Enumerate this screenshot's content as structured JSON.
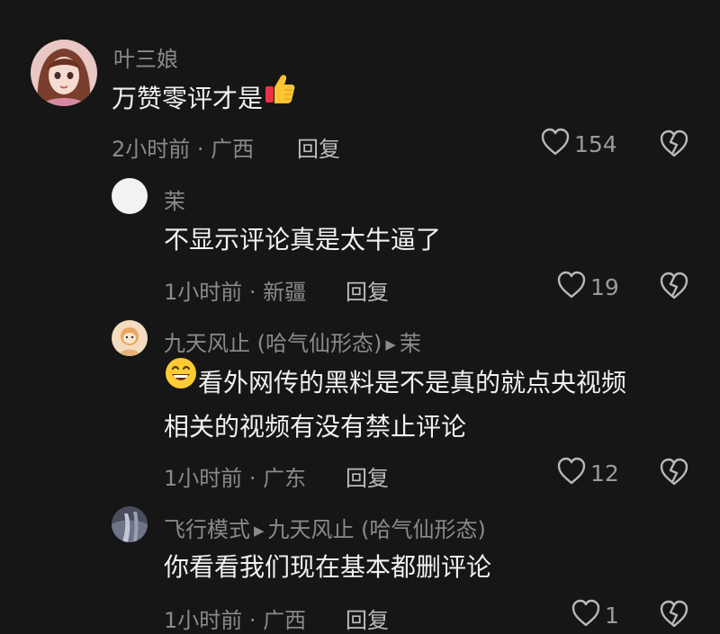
{
  "comments": [
    {
      "username": "叶三娘",
      "text": "万赞零评才是",
      "emoji": "thumbs-up",
      "time": "2小时前",
      "location": "广西",
      "reply_label": "回复",
      "likes": "154"
    },
    {
      "username": "茉",
      "text": "不显示评论真是太牛逼了",
      "time": "1小时前",
      "location": "新疆",
      "reply_label": "回复",
      "likes": "19"
    },
    {
      "username": "九天风止 (哈气仙形态)",
      "reply_to": "茉",
      "emoji": "grinning-face",
      "text_line1": "看外网传的黑料是不是真的就点央视频",
      "text_line2": "相关的视频有没有禁止评论",
      "time": "1小时前",
      "location": "广东",
      "reply_label": "回复",
      "likes": "12"
    },
    {
      "username": "飞行模式",
      "reply_to": "九天风止 (哈气仙形态)",
      "text": "你看看我们现在基本都删评论",
      "time": "1小时前",
      "location": "广西",
      "reply_label": "回复",
      "likes": "1"
    }
  ],
  "colors": {
    "background": "#161616",
    "primary_text": "#f0f0f0",
    "secondary_text": "#8a8a8a",
    "icon": "#b8b8b8"
  }
}
